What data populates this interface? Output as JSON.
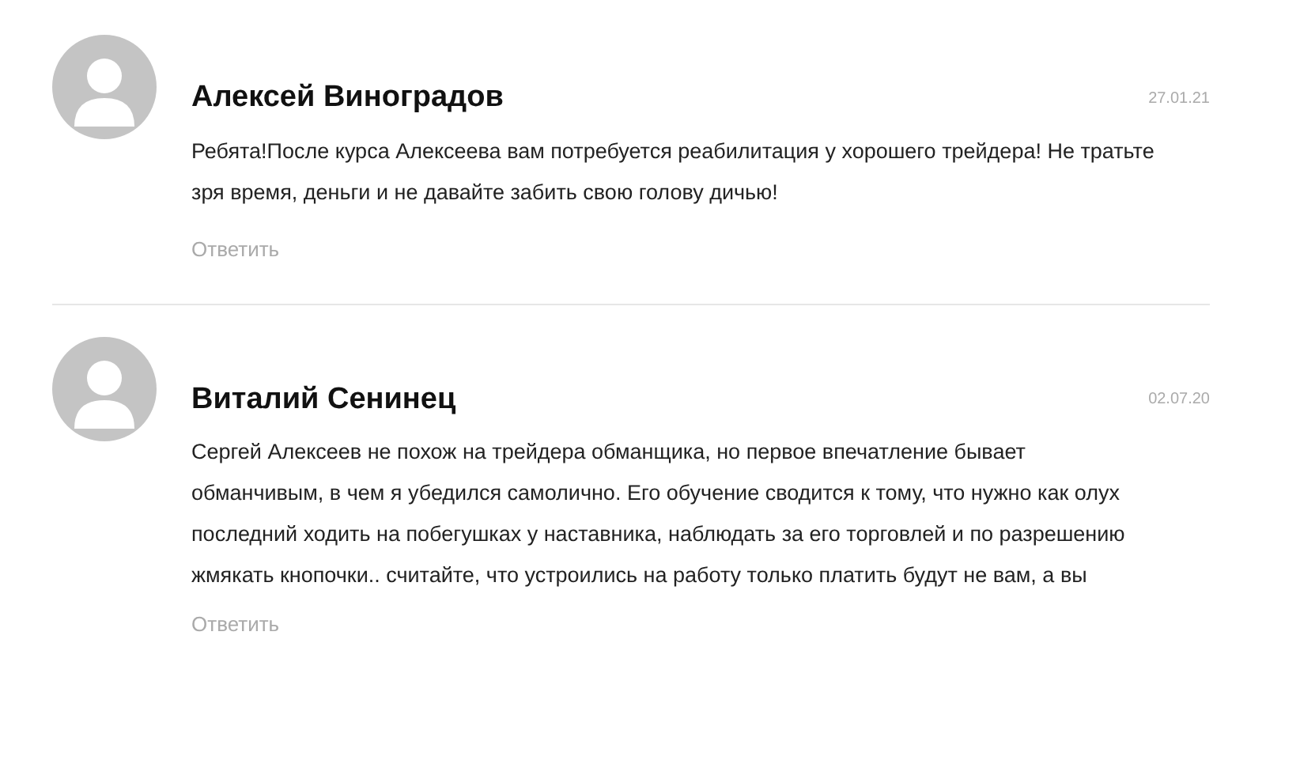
{
  "comments": [
    {
      "author": "Алексей Виноградов",
      "date": "27.01.21",
      "text": "Ребята!После курса Алексеева вам потребуется реабилитация у хорошего трейдера! Не тратьте зря время, деньги и не давайте забить свою голову дичью!",
      "reply": "Ответить"
    },
    {
      "author": "Виталий Сенинец",
      "date": "02.07.20",
      "text": "Сергей Алексеев не похож на трейдера обманщика, но первое впечатление бывает обманчивым, в чем я убедился самолично. Его обучение сводится к тому, что нужно как олух последний ходить на побегушках у наставника, наблюдать за его торговлей и по разрешению жмякать кнопочки.. считайте, что устроились на работу только платить будут не вам, а вы",
      "reply": "Ответить"
    }
  ]
}
